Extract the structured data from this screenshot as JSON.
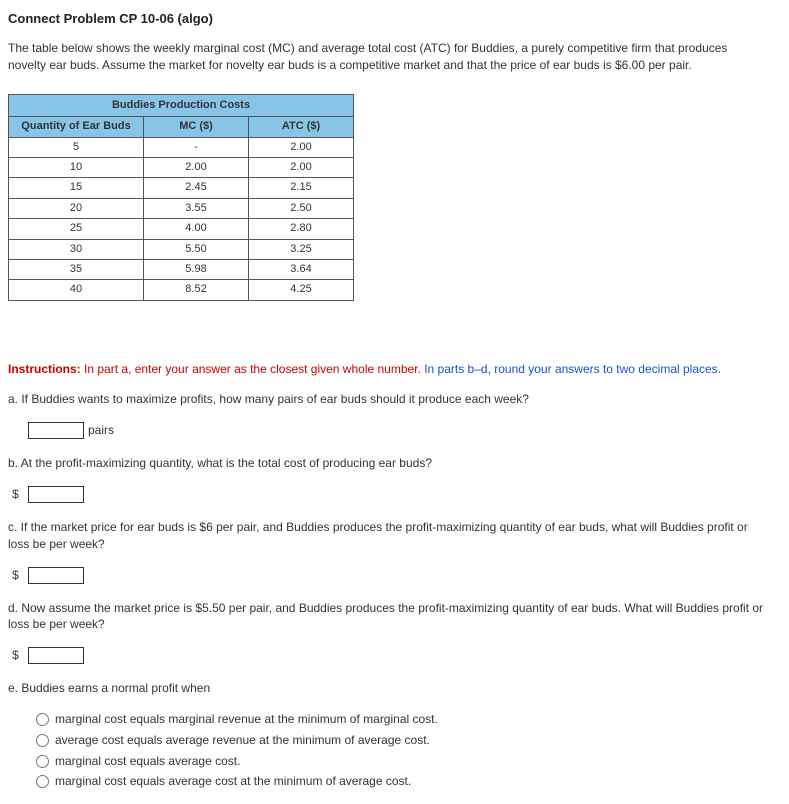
{
  "title": "Connect Problem CP 10-06 (algo)",
  "intro": "The table below shows the weekly marginal cost (MC) and average total cost (ATC) for Buddies, a purely competitive firm that produces novelty ear buds. Assume the market for novelty ear buds is a competitive market and that the price of ear buds is $6.00 per pair.",
  "table": {
    "caption": "Buddies Production Costs",
    "headers": {
      "q": "Quantity of Ear Buds",
      "mc": "MC ($)",
      "atc": "ATC ($)"
    },
    "rows": [
      {
        "q": "5",
        "mc": "-",
        "atc": "2.00"
      },
      {
        "q": "10",
        "mc": "2.00",
        "atc": "2.00"
      },
      {
        "q": "15",
        "mc": "2.45",
        "atc": "2.15"
      },
      {
        "q": "20",
        "mc": "3.55",
        "atc": "2.50"
      },
      {
        "q": "25",
        "mc": "4.00",
        "atc": "2.80"
      },
      {
        "q": "30",
        "mc": "5.50",
        "atc": "3.25"
      },
      {
        "q": "35",
        "mc": "5.98",
        "atc": "3.64"
      },
      {
        "q": "40",
        "mc": "8.52",
        "atc": "4.25"
      }
    ]
  },
  "instructions": {
    "label": "Instructions:",
    "red": " In part a, enter your answer as the closest given whole number.",
    "blue": " In parts b–d, round your answers to two decimal places."
  },
  "qa": {
    "text": "a. If Buddies wants to maximize profits, how many pairs of ear buds should it produce each week?",
    "unit": "pairs"
  },
  "qb": {
    "text": "b. At the profit-maximizing quantity, what is the total cost of producing ear buds?",
    "prefix": "$"
  },
  "qc": {
    "text": "c. If the market price for ear buds is $6 per pair, and Buddies produces the profit-maximizing quantity of ear buds, what will Buddies profit or loss be per week?",
    "prefix": "$"
  },
  "qd": {
    "text": "d. Now assume the market price is $5.50 per pair, and Buddies produces the profit-maximizing quantity of ear buds. What will Buddies profit or loss be per week?",
    "prefix": "$"
  },
  "qe": {
    "text": "e. Buddies earns a normal profit when",
    "options": [
      "marginal cost equals marginal revenue at the minimum of marginal cost.",
      "average cost equals average revenue at the minimum of average cost.",
      "marginal cost equals average cost.",
      "marginal cost equals average cost at the minimum of average cost."
    ]
  }
}
